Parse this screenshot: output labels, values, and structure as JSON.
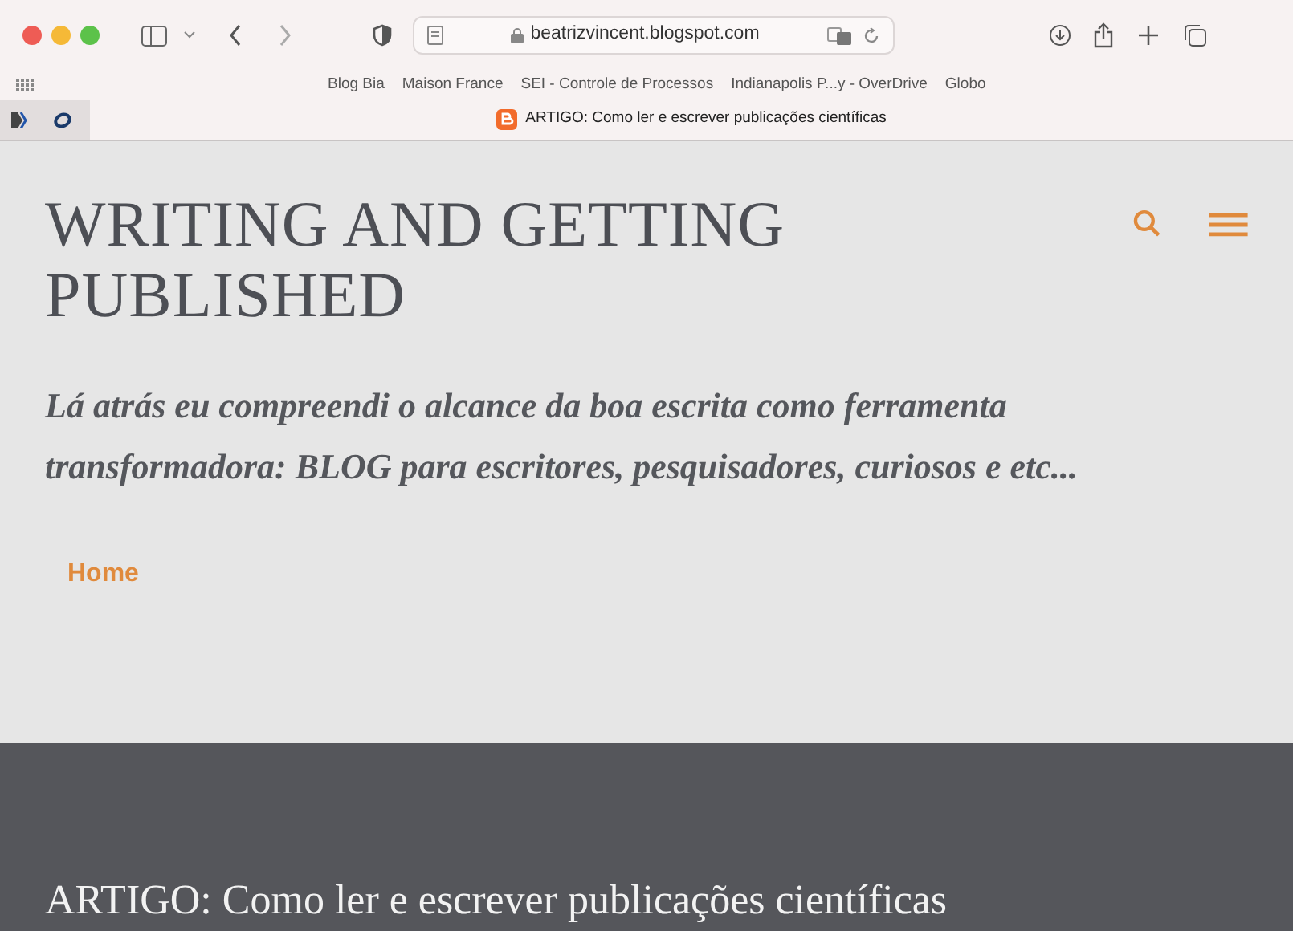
{
  "browser": {
    "url": "beatrizvincent.blogspot.com",
    "bookmarks": [
      "Blog Bia",
      "Maison France",
      "SEI - Controle de Processos",
      "Indianapolis P...y - OverDrive",
      "Globo"
    ],
    "tab": {
      "title": "ARTIGO: Como ler e escrever publicações científicas",
      "selected": true
    }
  },
  "blog": {
    "title": "WRITING AND GETTING PUBLISHED",
    "description": "Lá atrás eu compreendi o alcance da boa escrita como ferramenta transformadora: BLOG para escritores, pesquisadores, curiosos e etc...",
    "nav": [
      {
        "label": "Home",
        "selected": true
      }
    ],
    "post_title": "ARTIGO: Como ler e escrever publicações científicas"
  }
}
